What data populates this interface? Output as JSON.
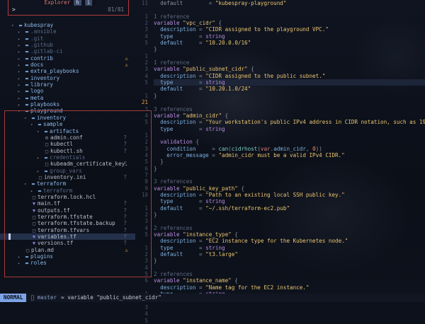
{
  "explorer": {
    "title": "Explorer",
    "key1": "h",
    "key2": "i",
    "prompt": ">",
    "counter": "81/81"
  },
  "tree": [
    {
      "label": "kubespray",
      "kind": "dir",
      "depth": 0,
      "open": true,
      "ln": "",
      "mark": ""
    },
    {
      "label": ".ansible",
      "kind": "dir-dim",
      "depth": 1,
      "ln": "",
      "mark": ""
    },
    {
      "label": ".git",
      "kind": "dir-dim",
      "depth": 1,
      "ln": "",
      "mark": ""
    },
    {
      "label": ".github",
      "kind": "dir-dim",
      "depth": 1,
      "ln": "",
      "mark": ""
    },
    {
      "label": ".gitlab-ci",
      "kind": "dir-dim",
      "depth": 1,
      "ln": "",
      "mark": ""
    },
    {
      "label": "contrib",
      "kind": "dir",
      "depth": 1,
      "ln": "",
      "mark": "warn"
    },
    {
      "label": "docs",
      "kind": "dir",
      "depth": 1,
      "ln": "",
      "mark": "warn"
    },
    {
      "label": "extra_playbooks",
      "kind": "dir",
      "depth": 1,
      "ln": "",
      "mark": ""
    },
    {
      "label": "inventory",
      "kind": "dir",
      "depth": 1,
      "ln": "",
      "mark": ""
    },
    {
      "label": "library",
      "kind": "dir",
      "depth": 1,
      "ln": "",
      "mark": ""
    },
    {
      "label": "logo",
      "kind": "dir",
      "depth": 1,
      "ln": "",
      "mark": ""
    },
    {
      "label": "meta",
      "kind": "dir",
      "depth": 1,
      "ln": "",
      "mark": ""
    },
    {
      "label": "playbooks",
      "kind": "dir",
      "depth": 1,
      "ln": "",
      "mark": ""
    },
    {
      "label": "playground",
      "kind": "dir",
      "depth": 1,
      "open": true,
      "ln": "",
      "mark": ""
    },
    {
      "label": "inventory",
      "kind": "dir",
      "depth": 2,
      "open": true,
      "ln": "",
      "mark": ""
    },
    {
      "label": "sample",
      "kind": "dir",
      "depth": 3,
      "open": true,
      "ln": "",
      "mark": ""
    },
    {
      "label": "artifacts",
      "kind": "dir",
      "depth": 4,
      "open": true,
      "ln": "",
      "mark": ""
    },
    {
      "label": "admin.conf",
      "kind": "gear",
      "depth": 5,
      "ln": "",
      "mark": "?"
    },
    {
      "label": "kubectl",
      "kind": "file",
      "depth": 5,
      "ln": "",
      "mark": "?"
    },
    {
      "label": "kubectl.sh",
      "kind": "file",
      "depth": 5,
      "ln": "",
      "mark": "?"
    },
    {
      "label": "credentials",
      "kind": "dir-dim",
      "depth": 4,
      "ln": "",
      "mark": ""
    },
    {
      "label": "kubeadm_certificate_key.",
      "kind": "file",
      "depth": 5,
      "ln": "",
      "mark": "?"
    },
    {
      "label": "group_vars",
      "kind": "dir-dim",
      "depth": 4,
      "ln": "",
      "mark": ""
    },
    {
      "label": "inventory.ini",
      "kind": "file",
      "depth": 4,
      "ln": "",
      "mark": "?"
    },
    {
      "label": "terraform",
      "kind": "dir",
      "depth": 2,
      "open": true,
      "ln": "",
      "mark": ""
    },
    {
      "label": "terraform",
      "kind": "dir-dim",
      "depth": 3,
      "ln": "",
      "mark": ""
    },
    {
      "label": "terraform.lock.hcl",
      "kind": "file",
      "depth": 3,
      "ln": "",
      "mark": ""
    },
    {
      "label": "main.tf",
      "kind": "tf",
      "depth": 3,
      "ln": "",
      "mark": "?"
    },
    {
      "label": "outputs.tf",
      "kind": "tf",
      "depth": 3,
      "ln": "",
      "mark": "?"
    },
    {
      "label": "terraform.tfstate",
      "kind": "file",
      "depth": 3,
      "ln": "",
      "mark": "?"
    },
    {
      "label": "terraform.tfstate.backup",
      "kind": "file",
      "depth": 3,
      "ln": "",
      "mark": "?"
    },
    {
      "label": "terraform.tfvars",
      "kind": "file",
      "depth": 3,
      "ln": "",
      "mark": "?"
    },
    {
      "label": "variables.tf",
      "kind": "tf",
      "depth": 3,
      "ln": "",
      "mark": "?",
      "selected": true
    },
    {
      "label": "versions.tf",
      "kind": "tf",
      "depth": 3,
      "ln": "",
      "mark": "?"
    },
    {
      "label": "plan.md",
      "kind": "file",
      "depth": 2,
      "ln": "",
      "mark": "warn"
    },
    {
      "label": "plugins",
      "kind": "dir",
      "depth": 1,
      "ln": "",
      "mark": ""
    },
    {
      "label": "roles",
      "kind": "dir",
      "depth": 1,
      "ln": "",
      "mark": ""
    }
  ],
  "gutter": [
    "11",
    "",
    "1",
    "2",
    "3",
    "4",
    "5",
    "",
    "1",
    "2",
    "3",
    "4",
    "5",
    "",
    "1",
    "21",
    "3",
    "4",
    "5",
    "",
    "1",
    "2",
    "3",
    "4",
    "5",
    "6",
    "7",
    "8",
    "9",
    "10",
    "",
    "1",
    "2",
    "3",
    "4",
    "5",
    "",
    "1",
    "2",
    "3",
    "4",
    "5",
    "6",
    "",
    "1",
    "2",
    "3",
    "4",
    "5"
  ],
  "code_lines": [
    [
      [
        "op",
        "  default        = "
      ],
      [
        "str",
        "\"kubespray-playground\""
      ]
    ],
    [],
    [
      [
        "ref",
        "1 reference"
      ]
    ],
    [
      [
        "kw",
        "variable "
      ],
      [
        "str",
        "\"vpc_cidr\""
      ],
      [
        "brace",
        " {"
      ]
    ],
    [
      [
        "attr",
        "  description"
      ],
      [
        "op",
        " = "
      ],
      [
        "str",
        "\"CIDR assigned to the playground VPC.\""
      ]
    ],
    [
      [
        "attr",
        "  type"
      ],
      [
        "op",
        "        = "
      ],
      [
        "kw",
        "string"
      ]
    ],
    [
      [
        "attr",
        "  default"
      ],
      [
        "op",
        "     = "
      ],
      [
        "str",
        "\"10.20.0.0/16\""
      ]
    ],
    [
      [
        "brace",
        "}"
      ]
    ],
    [],
    [
      [
        "ref",
        "1 reference"
      ]
    ],
    [
      [
        "kw",
        "variable "
      ],
      [
        "str",
        "\"public_subnet_cidr\""
      ],
      [
        "brace",
        " {"
      ]
    ],
    [
      [
        "attr",
        "  description"
      ],
      [
        "op",
        " = "
      ],
      [
        "str",
        "\"CIDR assigned to the public subnet.\""
      ]
    ],
    [
      [
        "attr",
        "  type"
      ],
      [
        "op",
        "        = "
      ],
      [
        "kw",
        "string"
      ]
    ],
    [
      [
        "attr",
        "  default"
      ],
      [
        "op",
        "     = "
      ],
      [
        "str",
        "\"10.20.1.0/24\""
      ]
    ],
    [
      [
        "brace",
        "}"
      ]
    ],
    [],
    [
      [
        "ref",
        "3 references"
      ]
    ],
    [
      [
        "kw",
        "variable "
      ],
      [
        "str",
        "\"admin_cidr\""
      ],
      [
        "brace",
        " {"
      ]
    ],
    [
      [
        "attr",
        "  description"
      ],
      [
        "op",
        " = "
      ],
      [
        "str",
        "\"Your workstation's public IPv4 address in CIDR notation, such as 198.51.1"
      ]
    ],
    [
      [
        "attr",
        "  type"
      ],
      [
        "op",
        "        = "
      ],
      [
        "kw",
        "string"
      ]
    ],
    [],
    [
      [
        "kw",
        "  validation"
      ],
      [
        "brace",
        " {"
      ]
    ],
    [
      [
        "attr",
        "    condition"
      ],
      [
        "op",
        "     = "
      ],
      [
        "fn",
        "can"
      ],
      [
        "op",
        "("
      ],
      [
        "fn",
        "cidrhost"
      ],
      [
        "op",
        "("
      ],
      [
        "var",
        "var"
      ],
      [
        "op",
        "."
      ],
      [
        "attr",
        "admin_cidr"
      ],
      [
        "op",
        ", "
      ],
      [
        "num",
        "0"
      ],
      [
        "op",
        "))"
      ]
    ],
    [
      [
        "attr",
        "    error_message"
      ],
      [
        "op",
        " = "
      ],
      [
        "str",
        "\"admin_cidr must be a valid IPv4 CIDR.\""
      ]
    ],
    [
      [
        "brace",
        "  }"
      ]
    ],
    [
      [
        "brace",
        "}"
      ]
    ],
    [],
    [
      [
        "ref",
        "3 references"
      ]
    ],
    [
      [
        "kw",
        "variable "
      ],
      [
        "str",
        "\"public_key_path\""
      ],
      [
        "brace",
        " {"
      ]
    ],
    [
      [
        "attr",
        "  description"
      ],
      [
        "op",
        " = "
      ],
      [
        "str",
        "\"Path to an existing local SSH public key.\""
      ]
    ],
    [
      [
        "attr",
        "  type"
      ],
      [
        "op",
        "        = "
      ],
      [
        "kw",
        "string"
      ]
    ],
    [
      [
        "attr",
        "  default"
      ],
      [
        "op",
        "     = "
      ],
      [
        "str",
        "\"~/.ssh/terraform-ec2.pub\""
      ]
    ],
    [
      [
        "brace",
        "}"
      ]
    ],
    [],
    [
      [
        "ref",
        "2 references"
      ]
    ],
    [
      [
        "kw",
        "variable "
      ],
      [
        "str",
        "\"instance_type\""
      ],
      [
        "brace",
        " {"
      ]
    ],
    [
      [
        "attr",
        "  description"
      ],
      [
        "op",
        " = "
      ],
      [
        "str",
        "\"EC2 instance type for the Kubernetes node.\""
      ]
    ],
    [
      [
        "attr",
        "  type"
      ],
      [
        "op",
        "        = "
      ],
      [
        "kw",
        "string"
      ]
    ],
    [
      [
        "attr",
        "  default"
      ],
      [
        "op",
        "     = "
      ],
      [
        "str",
        "\"t3.large\""
      ]
    ],
    [
      [
        "brace",
        "}"
      ]
    ],
    [],
    [
      [
        "ref",
        "2 references"
      ]
    ],
    [
      [
        "kw",
        "variable "
      ],
      [
        "str",
        "\"instance_name\""
      ],
      [
        "brace",
        " {"
      ]
    ],
    [
      [
        "attr",
        "  description"
      ],
      [
        "op",
        " = "
      ],
      [
        "str",
        "\"Name tag for the EC2 instance.\""
      ]
    ],
    [
      [
        "attr",
        "  type"
      ],
      [
        "op",
        "        = "
      ],
      [
        "kw",
        "string"
      ]
    ]
  ],
  "current_line_index": 12,
  "status": {
    "mode": "NORMAL",
    "branch": "master",
    "crumb": "variable \"public_subnet_cidr\""
  }
}
